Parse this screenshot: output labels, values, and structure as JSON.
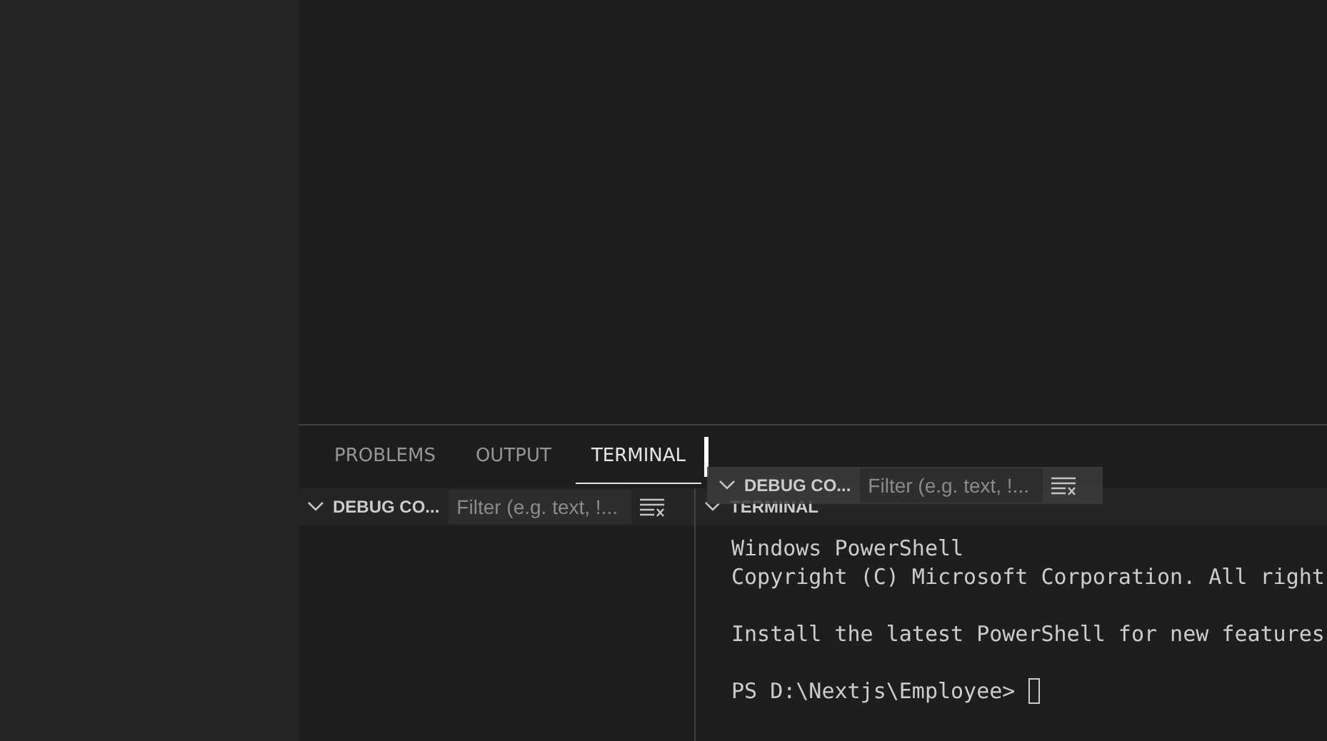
{
  "tabs": [
    {
      "label": "PROBLEMS",
      "selected": false
    },
    {
      "label": "OUTPUT",
      "selected": false
    },
    {
      "label": "TERMINAL",
      "selected": true
    }
  ],
  "debug_console_view": {
    "title": "DEBUG CO...",
    "filter": {
      "placeholder": "Filter (e.g. text, !..."
    }
  },
  "terminal_view": {
    "title": "TERMINAL",
    "blocks": [
      [
        "Windows PowerShell",
        "Copyright (C) Microsoft Corporation. All right"
      ],
      [
        "Install the latest PowerShell for new features"
      ],
      [
        "PS D:\\Nextjs\\Employee>"
      ]
    ]
  },
  "drag_preview": {
    "title": "DEBUG CO...",
    "filter": {
      "placeholder": "Filter (e.g. text, !..."
    }
  }
}
